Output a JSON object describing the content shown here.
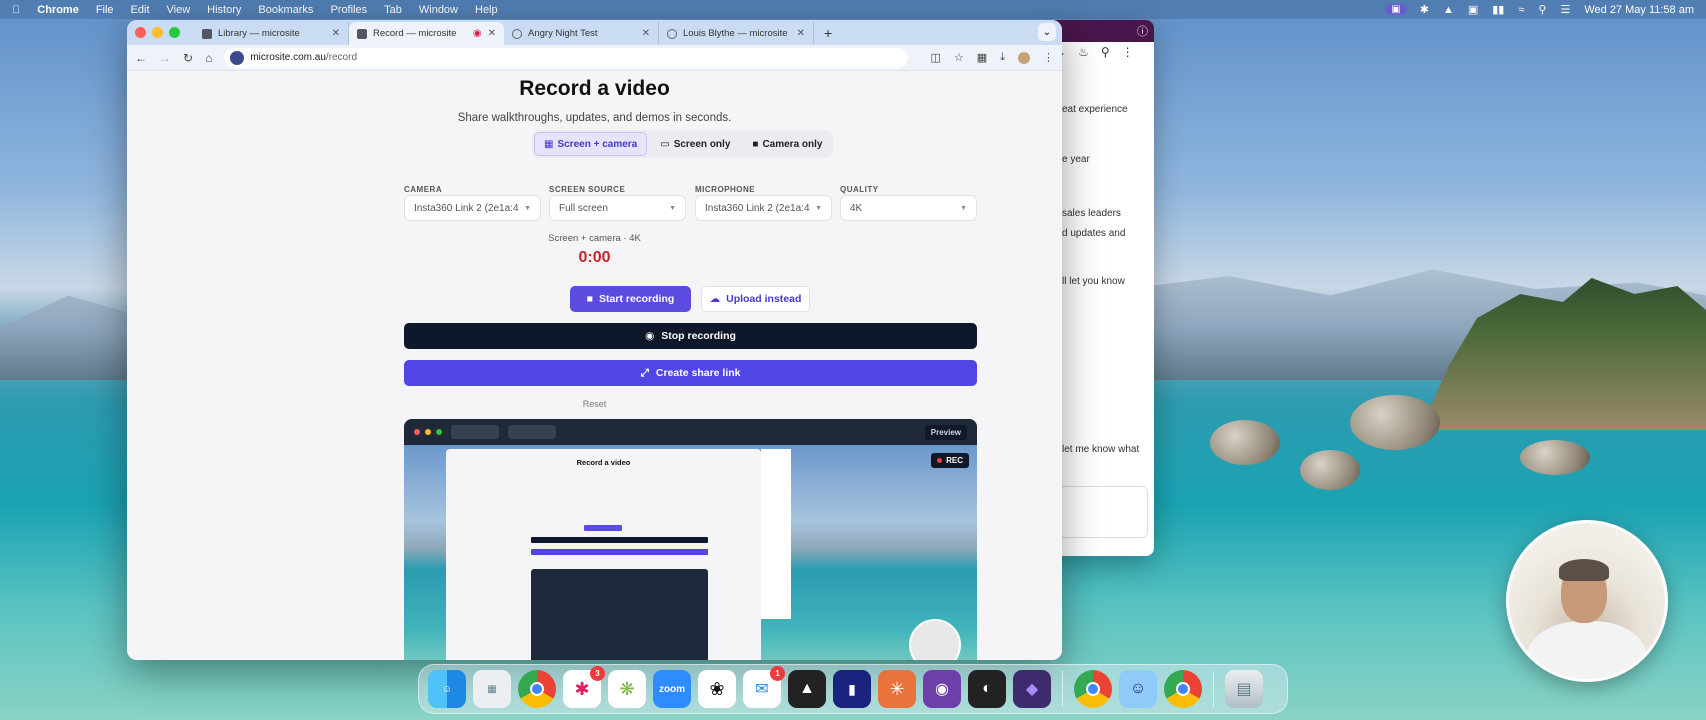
{
  "menubar": {
    "app_name": "Chrome",
    "items": [
      "File",
      "Edit",
      "View",
      "History",
      "Bookmarks",
      "Profiles",
      "Tab",
      "Window",
      "Help"
    ],
    "clock": "Wed 27 May  11:58 am"
  },
  "browser": {
    "tabs": [
      {
        "title": "Library — microsite",
        "icon": "doc-icon"
      },
      {
        "title": "Record — microsite",
        "icon": "doc-icon",
        "recording": true
      },
      {
        "title": "Angry Night Test",
        "icon": "globe-icon"
      },
      {
        "title": "Louis Blythe — microsite",
        "icon": "globe-icon"
      }
    ],
    "url_host": "microsite.com.au",
    "url_path": "/record"
  },
  "page": {
    "title": "Record a video",
    "subtitle": "Share walkthroughs, updates, and demos in seconds.",
    "modes": [
      "Screen + camera",
      "Screen only",
      "Camera only"
    ],
    "active_mode": "Screen + camera",
    "fields": [
      {
        "label": "CAMERA",
        "value": "Insta360 Link 2 (2e1a:4"
      },
      {
        "label": "SCREEN SOURCE",
        "value": "Full screen"
      },
      {
        "label": "MICROPHONE",
        "value": "Insta360 Link 2 (2e1a:4"
      },
      {
        "label": "QUALITY",
        "value": "4K"
      }
    ],
    "meta": "Screen + camera · 4K",
    "timer": "0:00",
    "start_label": "Start recording",
    "upload_label": "Upload instead",
    "stop_label": "Stop recording",
    "share_label": "Create share link",
    "reset_label": "Reset",
    "preview_label": "Preview",
    "rec_badge": "REC"
  },
  "preview_mini": {
    "title": "Record a video"
  },
  "back_window": {
    "snippets": [
      "eat experience",
      "e year",
      "sales leaders",
      "d updates and",
      "ll let you know",
      "let me know what"
    ]
  },
  "dock": {
    "apps": [
      {
        "name": "finder-icon",
        "color": "#1e88e5"
      },
      {
        "name": "launchpad-icon",
        "color": "#b0bec5"
      },
      {
        "name": "chrome-icon",
        "color": "#ffffff"
      },
      {
        "name": "slack-icon",
        "color": "#ffffff",
        "badge": "3"
      },
      {
        "name": "network-icon",
        "color": "#7cb342"
      },
      {
        "name": "zoom-icon",
        "color": "#2d8cff",
        "label": "zoom"
      },
      {
        "name": "chatgpt-icon",
        "color": "#ffffff"
      },
      {
        "name": "messages-icon",
        "color": "#ffffff",
        "badge": "1"
      },
      {
        "name": "cube-icon",
        "color": "#222222"
      },
      {
        "name": "app-icon",
        "color": "#1a237e"
      },
      {
        "name": "claude-icon",
        "color": "#e8743b"
      },
      {
        "name": "github-icon",
        "color": "#6e3fa8"
      },
      {
        "name": "linear-icon",
        "color": "#222222"
      },
      {
        "name": "obsidian-icon",
        "color": "#3d2b6e"
      },
      {
        "name": "chrome-icon-2",
        "color": "#ffffff"
      },
      {
        "name": "robot-icon",
        "color": "#90caf9"
      },
      {
        "name": "chrome-icon-3",
        "color": "#ffffff"
      },
      {
        "name": "trash-icon",
        "color": "#d0d4d8"
      }
    ]
  }
}
